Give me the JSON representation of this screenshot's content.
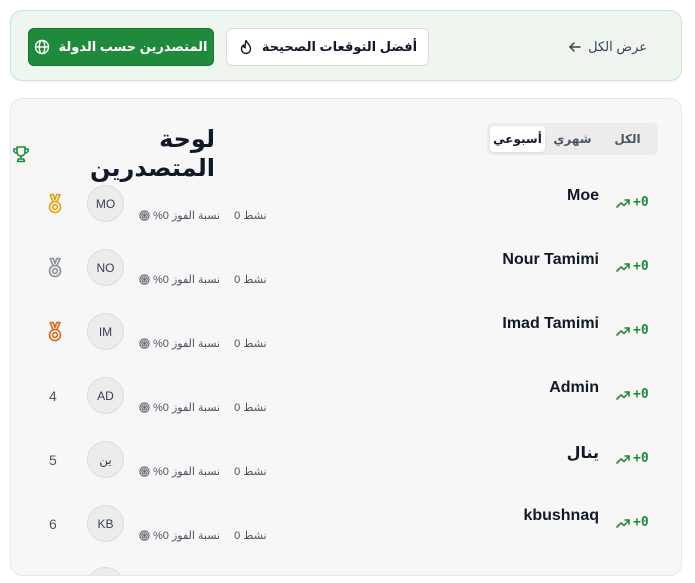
{
  "top": {
    "country_button": "المتصدرين حسب الدولة",
    "predictions_button": "أفضل التوقعات الصحيحة",
    "view_all": "عرض الكل"
  },
  "leaderboard": {
    "title": "لوحة المتصدرين",
    "tabs": [
      "الكل",
      "شهري",
      "أسبوعي"
    ],
    "active_tab": "أسبوعي",
    "stat_active_label": "نشط 0",
    "stat_win_label": "%نسبة الفوز 0",
    "rows": [
      {
        "rank": "1",
        "medal": "gold-medal-icon",
        "initials": "MO",
        "name": "Moe",
        "change": "+0"
      },
      {
        "rank": "2",
        "medal": "silver-medal-icon",
        "initials": "NO",
        "name": "Nour Tamimi",
        "change": "+0"
      },
      {
        "rank": "3",
        "medal": "bronze-medal-icon",
        "initials": "IM",
        "name": "Imad Tamimi",
        "change": "+0"
      },
      {
        "rank": "4",
        "medal": "",
        "initials": "AD",
        "name": "Admin",
        "change": "+0"
      },
      {
        "rank": "5",
        "medal": "",
        "initials": "ين",
        "name": "ينال",
        "change": "+0"
      },
      {
        "rank": "6",
        "medal": "",
        "initials": "KB",
        "name": "kbushnaq",
        "change": "+0"
      }
    ]
  },
  "colors": {
    "accent_green": "#1f8a3b",
    "gold": "#e0a20b",
    "silver": "#8a8f98",
    "bronze": "#d4691c"
  }
}
